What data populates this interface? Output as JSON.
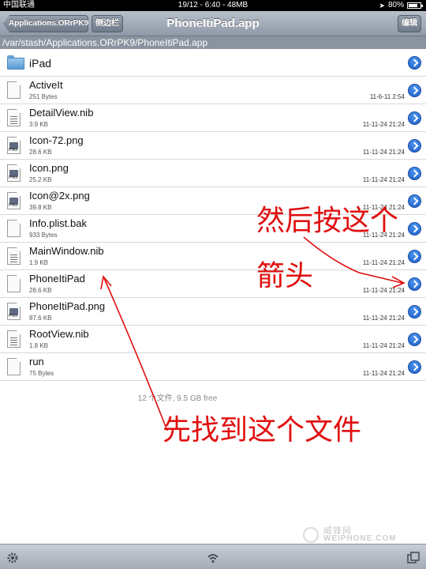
{
  "status_bar": {
    "carrier": "中国联通",
    "clock": "19/12 - 6:40 - 48MB",
    "battery": "80%",
    "battery_level": 0.8
  },
  "nav": {
    "back_label": "Applications.ORrPK9",
    "sidebar_label": "侧边栏",
    "title": "PhoneItiPad.app",
    "edit_label": "编辑"
  },
  "path": "/var/stash/Applications.ORrPK9/PhoneItiPad.app",
  "files": [
    {
      "name": "iPad",
      "size": "",
      "date": "",
      "icon": "folder-icon"
    },
    {
      "name": "ActiveIt",
      "size": "251 Bytes",
      "date": "11-6-11 2:54",
      "icon": "document-icon"
    },
    {
      "name": "DetailView.nib",
      "size": "3.9 KB",
      "date": "11-11-24 21:24",
      "icon": "nib-file-icon"
    },
    {
      "name": "Icon-72.png",
      "size": "28.6 KB",
      "date": "11-11-24 21:24",
      "icon": "png-file-icon"
    },
    {
      "name": "Icon.png",
      "size": "25.2 KB",
      "date": "11-11-24 21:24",
      "icon": "png-file-icon"
    },
    {
      "name": "Icon@2x.png",
      "size": "39.8 KB",
      "date": "11-11-24 21:24",
      "icon": "png-file-icon"
    },
    {
      "name": "Info.plist.bak",
      "size": "933 Bytes",
      "date": "11-11-24 21:24",
      "icon": "document-icon"
    },
    {
      "name": "MainWindow.nib",
      "size": "1.9 KB",
      "date": "11-11-24 21:24",
      "icon": "nib-file-icon"
    },
    {
      "name": "PhoneItiPad",
      "size": "28.6 KB",
      "date": "11-11-24 21:24",
      "icon": "document-icon"
    },
    {
      "name": "PhoneItiPad.png",
      "size": "87.6 KB",
      "date": "11-11-24 21:24",
      "icon": "png-file-icon"
    },
    {
      "name": "RootView.nib",
      "size": "1.8 KB",
      "date": "11-11-24 21:24",
      "icon": "nib-file-icon"
    },
    {
      "name": "run",
      "size": "75 Bytes",
      "date": "11-11-24 21:24",
      "icon": "document-icon"
    }
  ],
  "footer_info": "12 个文件, 9.5 GB free",
  "annotations": {
    "then_press": "然后按这个",
    "arrow": "箭头",
    "find_file": "先找到这个文件"
  },
  "watermark": {
    "text": "威锋网",
    "sub": "WEIPHONE.COM"
  },
  "colors": {
    "annotation": "#e01010",
    "disclosure": "#2a6fd6"
  }
}
